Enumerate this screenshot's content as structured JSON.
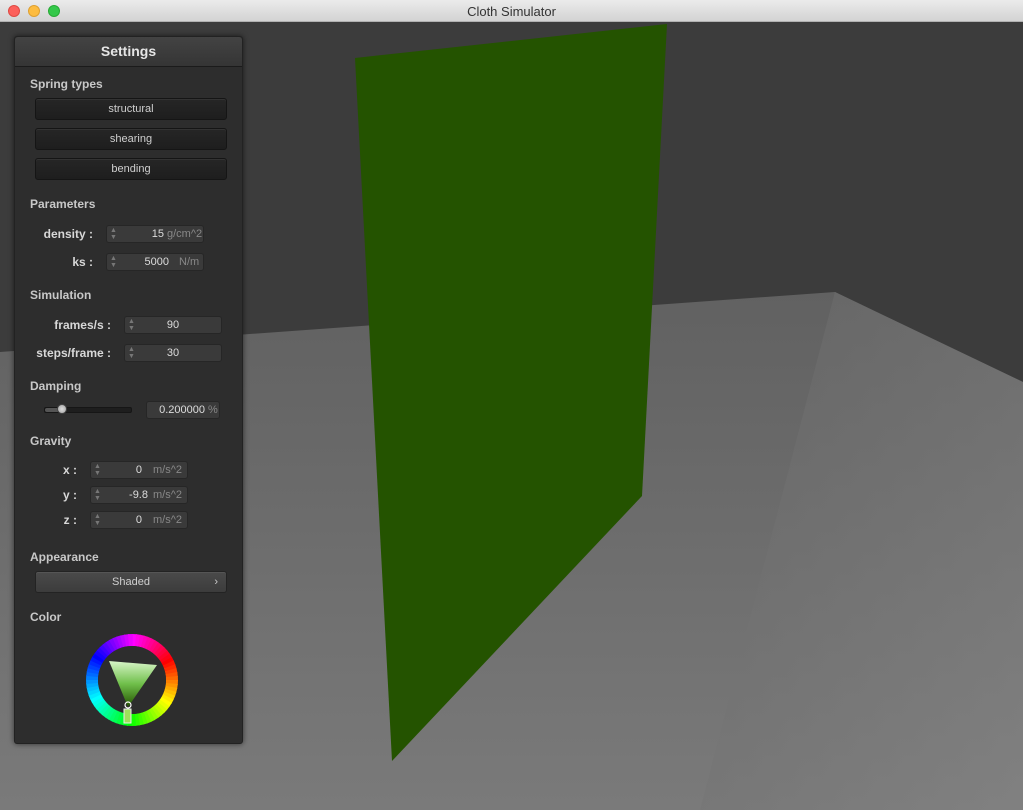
{
  "window": {
    "title": "Cloth Simulator"
  },
  "scene": {
    "cloth_color": "#245300",
    "floor_color": "#6a6a6a",
    "wall_color": "#3b3b3b"
  },
  "settings": {
    "title": "Settings",
    "spring_types": {
      "label": "Spring types",
      "buttons": [
        "structural",
        "shearing",
        "bending"
      ]
    },
    "parameters": {
      "label": "Parameters",
      "density": {
        "label": "density :",
        "value": "15",
        "unit": "g/cm^2"
      },
      "ks": {
        "label": "ks :",
        "value": "5000",
        "unit": "N/m"
      }
    },
    "simulation": {
      "label": "Simulation",
      "frames": {
        "label": "frames/s :",
        "value": "90"
      },
      "steps": {
        "label": "steps/frame :",
        "value": "30"
      }
    },
    "damping": {
      "label": "Damping",
      "value": "0.200000",
      "unit": "%",
      "slider_fraction": 0.2
    },
    "gravity": {
      "label": "Gravity",
      "x": {
        "label": "x :",
        "value": "0",
        "unit": "m/s^2"
      },
      "y": {
        "label": "y :",
        "value": "-9.8",
        "unit": "m/s^2"
      },
      "z": {
        "label": "z :",
        "value": "0",
        "unit": "m/s^2"
      }
    },
    "appearance": {
      "label": "Appearance",
      "selected": "Shaded",
      "chevron": "›"
    },
    "color": {
      "label": "Color",
      "selected_color": "#245300"
    }
  }
}
